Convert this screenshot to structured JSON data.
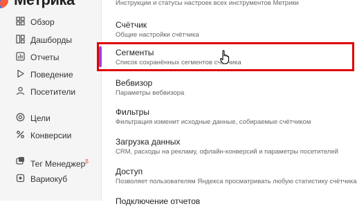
{
  "app": {
    "title": "Метрика"
  },
  "sidebar": {
    "items": [
      {
        "label": "Обзор",
        "icon": "grid-icon"
      },
      {
        "label": "Дашборды",
        "icon": "dashboard-icon"
      },
      {
        "label": "Отчеты",
        "icon": "reports-icon"
      },
      {
        "label": "Поведение",
        "icon": "play-icon"
      },
      {
        "label": "Посетители",
        "icon": "person-icon"
      },
      {
        "label": "Цели",
        "icon": "target-icon"
      },
      {
        "label": "Конверсии",
        "icon": "percent-icon"
      },
      {
        "label": "Тег Менеджер",
        "icon": "tag-icon",
        "badge": "β"
      },
      {
        "label": "Вариокуб",
        "icon": "cube-icon"
      }
    ]
  },
  "settings": {
    "top_desc": "Инструкции и статусы настроек всех инструментов Метрики",
    "items": [
      {
        "title": "Счётчик",
        "desc": "Общие настройки счётчика"
      },
      {
        "title": "Сегменты",
        "desc": "Список сохранённых сегментов счётчика"
      },
      {
        "title": "Вебвизор",
        "desc": "Параметры вебвизора"
      },
      {
        "title": "Фильтры",
        "desc": "Фильтрация изменит исходные данные, собираемые счётчиком"
      },
      {
        "title": "Загрузка данных",
        "desc": "CRM, расходы на рекламу, офлайн-конверсий и параметры посетителей"
      },
      {
        "title": "Доступ",
        "desc": "Позволяет пользователям Яндекса просматривать любую статистику счётчика"
      },
      {
        "title": "Подключение отчетов",
        "desc": ""
      }
    ]
  },
  "colors": {
    "highlight": "#e00000",
    "accent": "#9b3de0"
  }
}
